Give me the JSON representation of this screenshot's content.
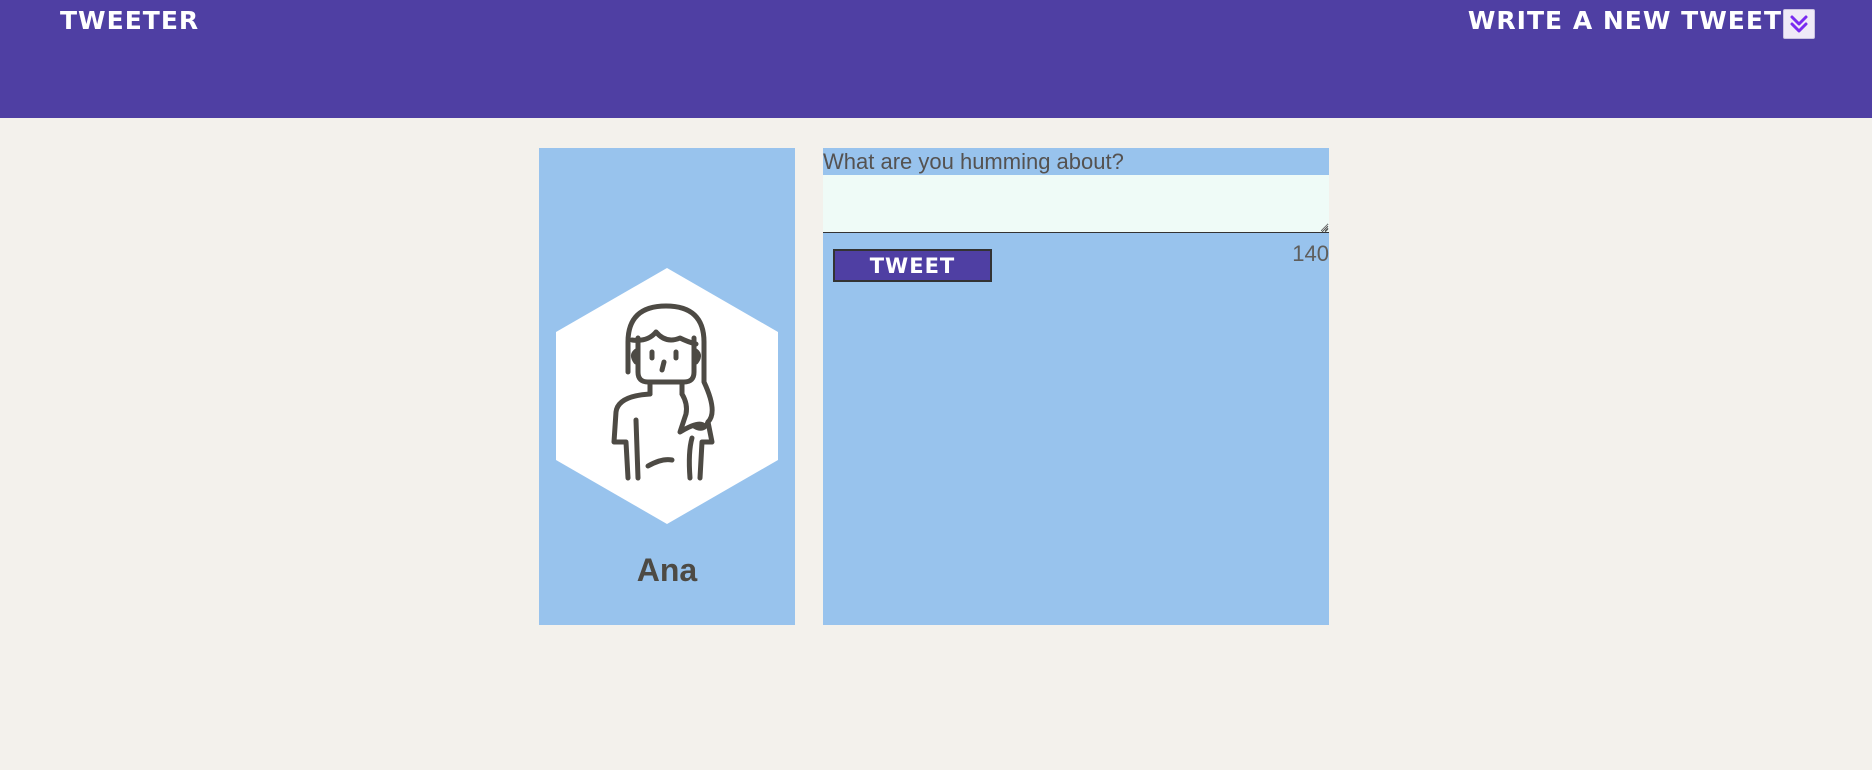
{
  "header": {
    "brand": "TWEETER",
    "write_link": "WRITE A NEW TWEET",
    "toggle_icon": "double-chevron-down-icon",
    "background": "#4f3fa3"
  },
  "profile": {
    "name": "Ana",
    "avatar_icon": "woman-avatar-icon",
    "card_color": "#98c3ed"
  },
  "composer": {
    "label": "What are you humming about?",
    "input_value": "",
    "button_label": "TWEET",
    "char_count": "140"
  },
  "colors": {
    "accent": "#4f3fa3",
    "panel": "#98c3ed",
    "page_background": "#f3f1ec",
    "input_background": "#effbf7"
  }
}
